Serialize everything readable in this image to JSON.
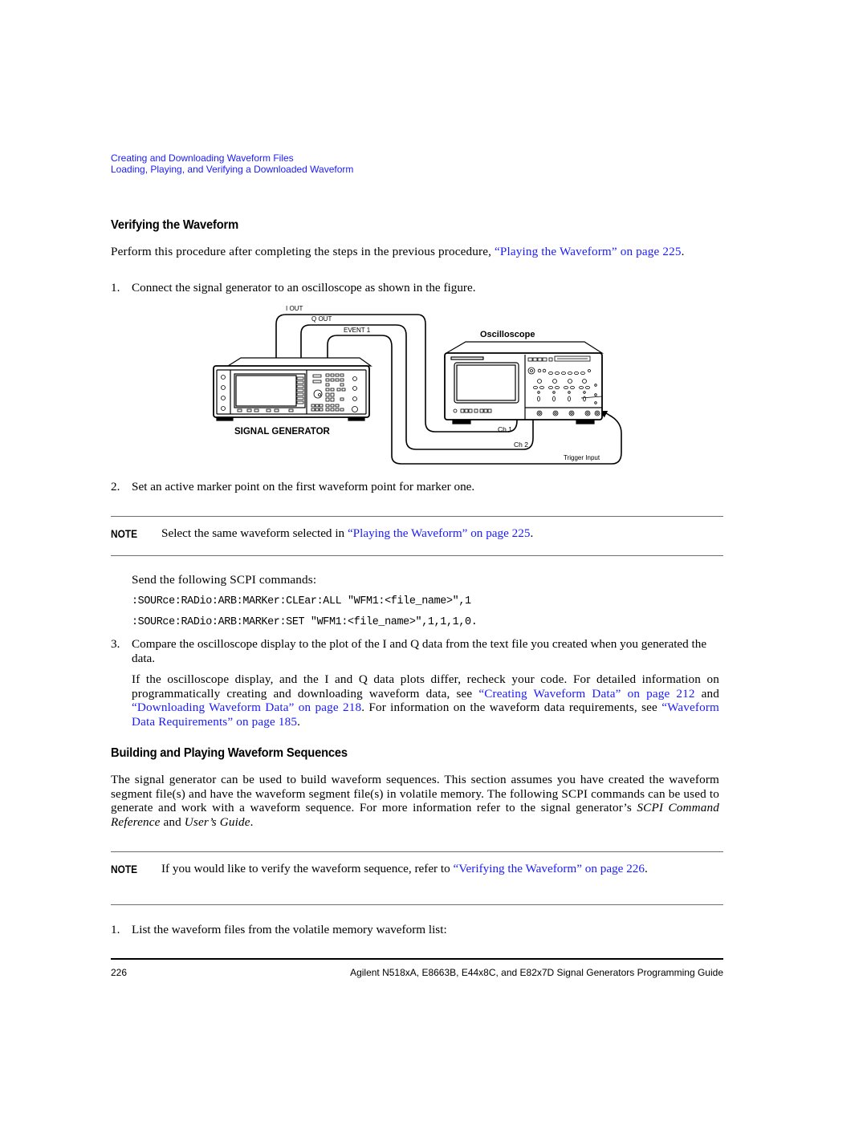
{
  "breadcrumb": {
    "chapter": "Creating and Downloading Waveform Files",
    "section": "Loading, Playing, and Verifying a Downloaded Waveform"
  },
  "section1": {
    "title": "Verifying the Waveform",
    "intro_text": "Perform this procedure after completing the steps in the previous procedure, ",
    "intro_link": "“Playing the Waveform” on page 225",
    "intro_end": ".",
    "steps": [
      {
        "num": "1.",
        "text": "Connect the signal generator to an oscilloscope as shown in the figure."
      },
      {
        "num": "2.",
        "text": "Set an active marker point on the first waveform point for marker one."
      },
      {
        "num": "3.",
        "text": "Compare the oscilloscope display to the plot of the I and Q data from the text file you created when you generated the data."
      }
    ],
    "figure": {
      "signal_generator_label": "SIGNAL GENERATOR",
      "oscilloscope_label": "Oscilloscope",
      "cable_i": "I OUT",
      "cable_q": "Q OUT",
      "cable_event": "EVENT 1",
      "input_ch1": "Ch 1",
      "input_ch2": "Ch 2",
      "input_trigger": "Trigger Input"
    },
    "note": {
      "label": "NOTE",
      "text": "Select the same waveform selected in ",
      "link": "“Playing the Waveform” on page 225",
      "end": "."
    },
    "send_text": "Send the following SCPI commands:",
    "commands": [
      ":SOURce:RADio:ARB:MARKer:CLEar:ALL \"WFM1:<file_name>\",1",
      ":SOURce:RADio:ARB:MARKer:SET \"WFM1:<file_name>\",1,1,1,0."
    ],
    "recheck": {
      "text1": "If the oscilloscope display, and the I and Q data plots differ, recheck your code. For detailed information on programmatically creating and downloading waveform data, see ",
      "link1": "“Creating Waveform Data” on page 212",
      "text2": " and ",
      "link2": "“Downloading Waveform Data” on page 218",
      "text3": ". For information on the waveform data requirements, see ",
      "link3": "“Waveform Data Requirements” on page 185",
      "text4": "."
    }
  },
  "section2": {
    "title": "Building and Playing Waveform Sequences",
    "para_text1": "The signal generator can be used to build waveform sequences. This section assumes you have created the waveform segment file(s) and have the waveform segment file(s) in volatile memory. The following SCPI commands can be used to generate and work with a waveform sequence. For more information refer to the signal generator’s ",
    "para_italic1": "SCPI Command Reference",
    "para_text2": " and ",
    "para_italic2": "User’s Guide",
    "para_text3": ".",
    "note": {
      "label": "NOTE",
      "text": "If you would like to verify the waveform sequence, refer to ",
      "link": "“Verifying the Waveform” on page 226",
      "end": "."
    },
    "steps": [
      {
        "num": "1.",
        "text": "List the waveform files from the volatile memory waveform list:"
      }
    ]
  },
  "footer": {
    "page_number": "226",
    "title": "Agilent N518xA, E8663B, E44x8C, and E82x7D Signal Generators Programming Guide"
  },
  "colors": {
    "link": "#1a1aff",
    "text": "#000000",
    "rule": "#6e6e6e"
  }
}
